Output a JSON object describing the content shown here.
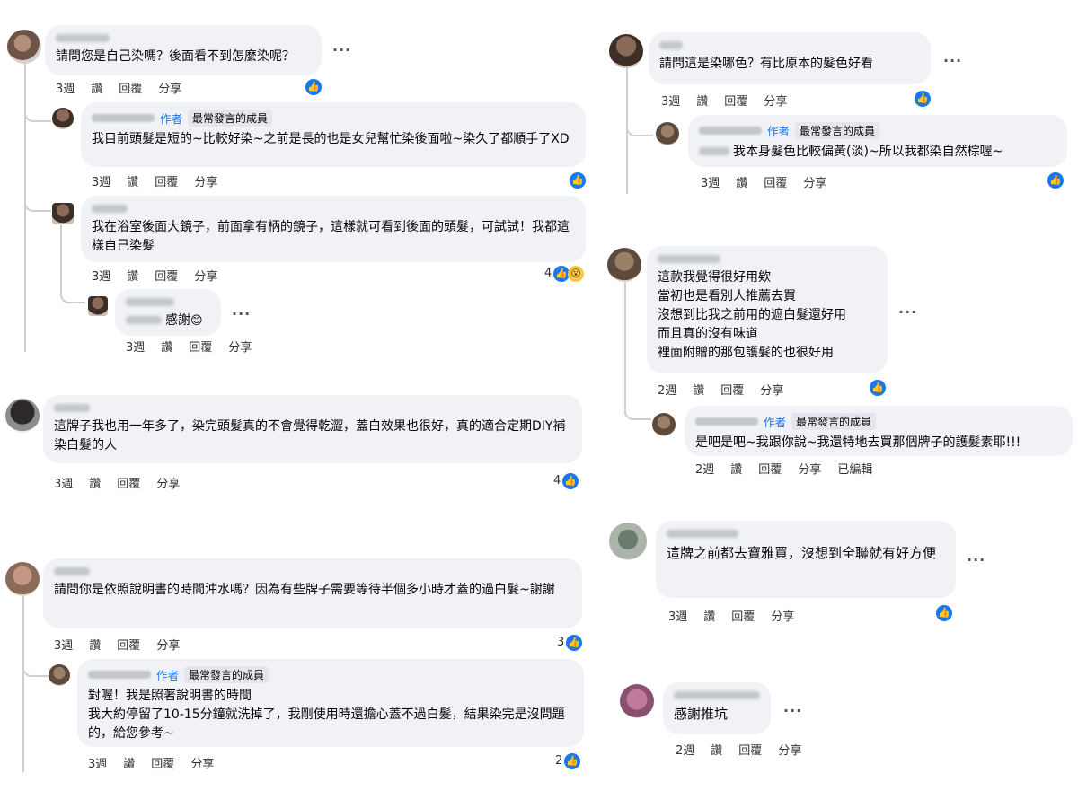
{
  "thread_a": {
    "c1": {
      "text": "請問您是自己染嗎？後面看不到怎麼染呢？",
      "time": "3週",
      "like": "讚",
      "reply": "回覆",
      "share": "分享"
    },
    "r1": {
      "author_label": "作者",
      "top_label": "最常發言的成員",
      "text": "我目前頭髮是短的~比較好染~之前是長的也是女兒幫忙染後面啦~染久了都順手了XD",
      "time": "3週",
      "like": "讚",
      "reply": "回覆",
      "share": "分享"
    },
    "r2": {
      "text": "我在浴室後面大鏡子，前面拿有柄的鏡子，這樣就可看到後面的頭髮，可試試！我都這樣自己染髮",
      "time": "3週",
      "like": "讚",
      "reply": "回覆",
      "share": "分享",
      "reactions": "4"
    },
    "r3": {
      "text": "感謝",
      "time": "3週",
      "like": "讚",
      "reply": "回覆",
      "share": "分享"
    }
  },
  "thread_b": {
    "c1": {
      "text": "這牌子我也用一年多了，染完頭髮真的不會覺得乾澀，蓋白效果也很好，真的適合定期DIY補染白髮的人",
      "time": "3週",
      "like": "讚",
      "reply": "回覆",
      "share": "分享",
      "reactions": "4"
    }
  },
  "thread_c": {
    "c1": {
      "text": "請問你是依照說明書的時間沖水嗎？因為有些牌子需要等待半個多小時才蓋的過白髮~謝謝",
      "time": "3週",
      "like": "讚",
      "reply": "回覆",
      "share": "分享",
      "reactions": "3"
    },
    "r1": {
      "author_label": "作者",
      "top_label": "最常發言的成員",
      "text": "對喔！我是照著說明書的時間\n我大約停留了10-15分鐘就洗掉了，我剛使用時還擔心蓋不過白髮，結果染完是沒問題的，給您參考~",
      "time": "3週",
      "like": "讚",
      "reply": "回覆",
      "share": "分享",
      "reactions": "2"
    }
  },
  "thread_d": {
    "c1": {
      "text": "請問這是染哪色？有比原本的髮色好看",
      "time": "3週",
      "like": "讚",
      "reply": "回覆",
      "share": "分享"
    },
    "r1": {
      "author_label": "作者",
      "top_label": "最常發言的成員",
      "text": "我本身髮色比較偏黃(淡)~所以我都染自然棕喔~",
      "time": "3週",
      "like": "讚",
      "reply": "回覆",
      "share": "分享"
    }
  },
  "thread_e": {
    "c1": {
      "text": "這款我覺得很好用欸\n當初也是看別人推薦去買\n沒想到比我之前用的遮白髮還好用\n而且真的沒有味道\n裡面附贈的那包護髮的也很好用",
      "time": "2週",
      "like": "讚",
      "reply": "回覆",
      "share": "分享"
    },
    "r1": {
      "author_label": "作者",
      "top_label": "最常發言的成員",
      "text": "是吧是吧~我跟你說~我還特地去買那個牌子的護髮素耶!!!",
      "time": "2週",
      "like": "讚",
      "reply": "回覆",
      "share": "分享",
      "edited": "已編輯"
    }
  },
  "thread_f": {
    "c1": {
      "text": "這牌之前都去寶雅買，沒想到全聯就有好方便",
      "time": "3週",
      "like": "讚",
      "reply": "回覆",
      "share": "分享"
    }
  },
  "thread_g": {
    "c1": {
      "text": "感謝推坑",
      "time": "2週",
      "like": "讚",
      "reply": "回覆",
      "share": "分享"
    }
  },
  "icons": {
    "like": "thumbs-up-icon",
    "wow": "wow-emoji-icon",
    "more": "more-options-icon",
    "emoji": "smile-emoji-icon"
  },
  "colors": {
    "accent": "#1877f2",
    "bubble": "#f0f2f5"
  }
}
